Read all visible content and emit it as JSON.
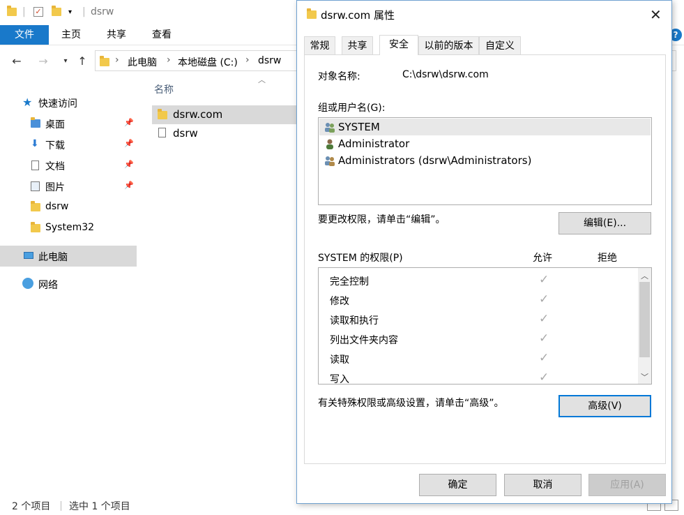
{
  "explorer": {
    "window_title": "dsrw",
    "ribbon_tabs": [
      "文件",
      "主页",
      "共享",
      "查看"
    ],
    "breadcrumb": [
      "此电脑",
      "本地磁盘 (C:)",
      "dsrw"
    ],
    "nav": {
      "quick_access": "快速访问",
      "items": [
        "桌面",
        "下载",
        "文档",
        "图片",
        "dsrw",
        "System32"
      ],
      "this_pc": "此电脑",
      "network": "网络"
    },
    "column_name": "名称",
    "files": [
      {
        "name": "dsrw.com",
        "type": "folder",
        "selected": true
      },
      {
        "name": "dsrw",
        "type": "file",
        "selected": false
      }
    ],
    "status": {
      "count": "2 个项目",
      "selected": "选中 1 个项目"
    },
    "help": "?"
  },
  "dialog": {
    "title": "dsrw.com 属性",
    "close": "✕",
    "tabs": [
      "常规",
      "共享",
      "安全",
      "以前的版本",
      "自定义"
    ],
    "active_tab": "安全",
    "object_label": "对象名称:",
    "object_value": "C:\\dsrw\\dsrw.com",
    "group_label": "组或用户名(G):",
    "users": [
      {
        "name": "SYSTEM",
        "icon": "users-group-icon",
        "selected": true
      },
      {
        "name": "Administrator",
        "icon": "user-icon",
        "selected": false
      },
      {
        "name": "Administrators (dsrw\\Administrators)",
        "icon": "users-group-icon",
        "selected": false
      }
    ],
    "change_hint": "要更改权限，请单击“编辑”。",
    "edit_button": "编辑(E)...",
    "perm_label": "SYSTEM 的权限(P)",
    "allow_label": "允许",
    "deny_label": "拒绝",
    "permissions": [
      {
        "name": "完全控制",
        "allow": "✓"
      },
      {
        "name": "修改",
        "allow": "✓"
      },
      {
        "name": "读取和执行",
        "allow": "✓"
      },
      {
        "name": "列出文件夹内容",
        "allow": "✓"
      },
      {
        "name": "读取",
        "allow": "✓"
      },
      {
        "name": "写入",
        "allow": "✓"
      }
    ],
    "advanced_hint": "有关特殊权限或高级设置，请单击“高级”。",
    "advanced_button": "高级(V)",
    "ok_button": "确定",
    "cancel_button": "取消",
    "apply_button": "应用(A)"
  },
  "colors": {
    "accent": "#1979ca",
    "selection": "#d9d9d9",
    "folder": "#f2c94c",
    "dialog_border": "#6fa1d0"
  }
}
